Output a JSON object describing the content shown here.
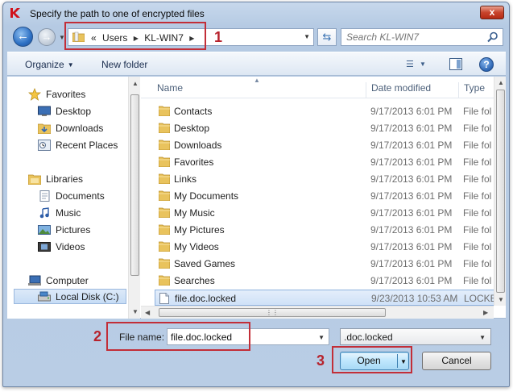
{
  "window": {
    "title": "Specify the path to one of encrypted files",
    "close_label": "x"
  },
  "address_bar": {
    "crumbs": [
      "«",
      "Users",
      "KL-WIN7"
    ],
    "search_placeholder": "Search KL-WIN7"
  },
  "toolbar": {
    "organize_label": "Organize",
    "new_folder_label": "New folder"
  },
  "nav_pane": {
    "groups": [
      {
        "label": "Favorites",
        "icon": "star-icon",
        "items": [
          {
            "label": "Desktop",
            "icon": "desktop-icon"
          },
          {
            "label": "Downloads",
            "icon": "downloads-icon"
          },
          {
            "label": "Recent Places",
            "icon": "recent-places-icon"
          }
        ]
      },
      {
        "label": "Libraries",
        "icon": "libraries-icon",
        "items": [
          {
            "label": "Documents",
            "icon": "documents-icon"
          },
          {
            "label": "Music",
            "icon": "music-icon"
          },
          {
            "label": "Pictures",
            "icon": "pictures-icon"
          },
          {
            "label": "Videos",
            "icon": "videos-icon"
          }
        ]
      },
      {
        "label": "Computer",
        "icon": "computer-icon",
        "items": [
          {
            "label": "Local Disk (C:)",
            "icon": "drive-icon",
            "selected": true
          }
        ]
      }
    ]
  },
  "file_list": {
    "columns": {
      "name": "Name",
      "date": "Date modified",
      "type": "Type"
    },
    "rows": [
      {
        "name": "Contacts",
        "date": "9/17/2013 6:01 PM",
        "type": "File fol",
        "icon": "folder-icon"
      },
      {
        "name": "Desktop",
        "date": "9/17/2013 6:01 PM",
        "type": "File fol",
        "icon": "folder-icon"
      },
      {
        "name": "Downloads",
        "date": "9/17/2013 6:01 PM",
        "type": "File fol",
        "icon": "folder-icon"
      },
      {
        "name": "Favorites",
        "date": "9/17/2013 6:01 PM",
        "type": "File fol",
        "icon": "folder-icon"
      },
      {
        "name": "Links",
        "date": "9/17/2013 6:01 PM",
        "type": "File fol",
        "icon": "folder-icon"
      },
      {
        "name": "My Documents",
        "date": "9/17/2013 6:01 PM",
        "type": "File fol",
        "icon": "folder-icon"
      },
      {
        "name": "My Music",
        "date": "9/17/2013 6:01 PM",
        "type": "File fol",
        "icon": "folder-icon"
      },
      {
        "name": "My Pictures",
        "date": "9/17/2013 6:01 PM",
        "type": "File fol",
        "icon": "folder-icon"
      },
      {
        "name": "My Videos",
        "date": "9/17/2013 6:01 PM",
        "type": "File fol",
        "icon": "folder-icon"
      },
      {
        "name": "Saved Games",
        "date": "9/17/2013 6:01 PM",
        "type": "File fol",
        "icon": "folder-icon"
      },
      {
        "name": "Searches",
        "date": "9/17/2013 6:01 PM",
        "type": "File fol",
        "icon": "folder-icon"
      },
      {
        "name": "file.doc.locked",
        "date": "9/23/2013 10:53 AM",
        "type": "LOCKE",
        "icon": "file-icon",
        "selected": true
      }
    ]
  },
  "bottom": {
    "file_name_label": "File name:",
    "file_name_value": "file.doc.locked",
    "file_type_value": ".doc.locked",
    "open_label": "Open",
    "cancel_label": "Cancel"
  },
  "annotations": [
    "1",
    "2",
    "3"
  ],
  "colors": {
    "annotation": "#c22e38",
    "selection": "#cfe1f7",
    "accent": "#2d70c4"
  }
}
